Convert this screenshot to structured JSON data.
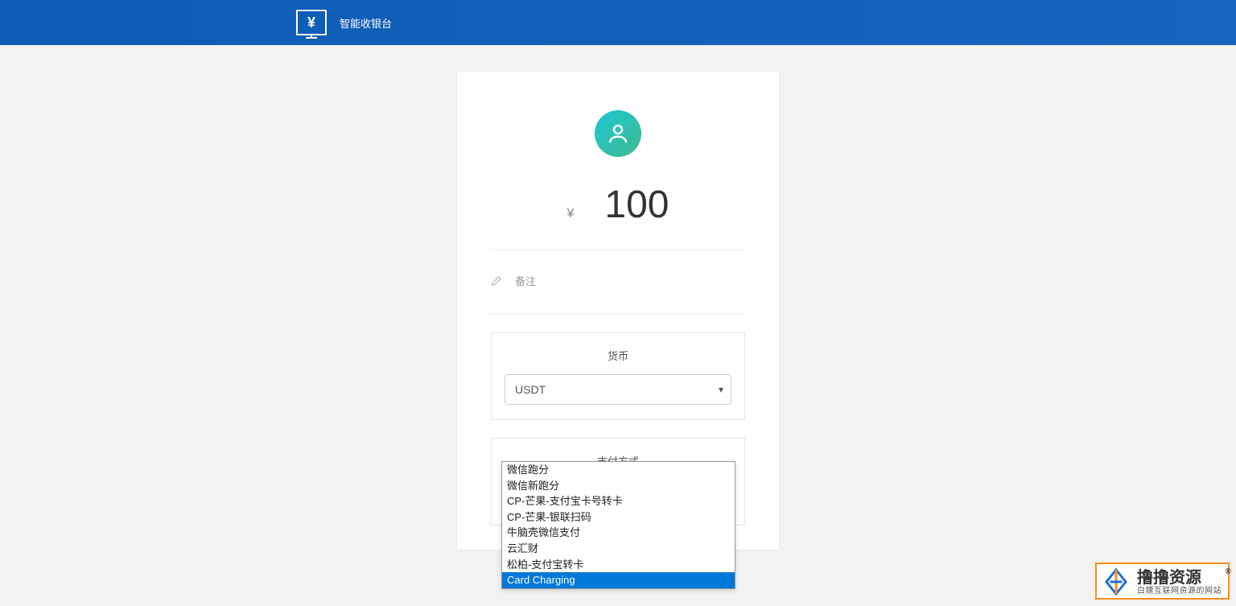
{
  "header": {
    "title": "智能收银台"
  },
  "amount": {
    "currency_symbol": "¥",
    "value": "100"
  },
  "remark": {
    "label": "备注"
  },
  "currency_section": {
    "label": "货币",
    "selected": "USDT",
    "options": [
      "USDT"
    ]
  },
  "payment_section": {
    "label": "支付方式",
    "selected": "Card Charging",
    "options": [
      "微信跑分",
      "微信新跑分",
      "CP-芒果-支付宝卡号转卡",
      "CP-芒果-银联扫码",
      "牛脑壳微信支付",
      "云汇财",
      "松柏-支付宝转卡",
      "Card Charging"
    ]
  },
  "watermark": {
    "main": "撸撸资源",
    "reg": "®",
    "sub": "白嫖互联网资源的网站"
  }
}
